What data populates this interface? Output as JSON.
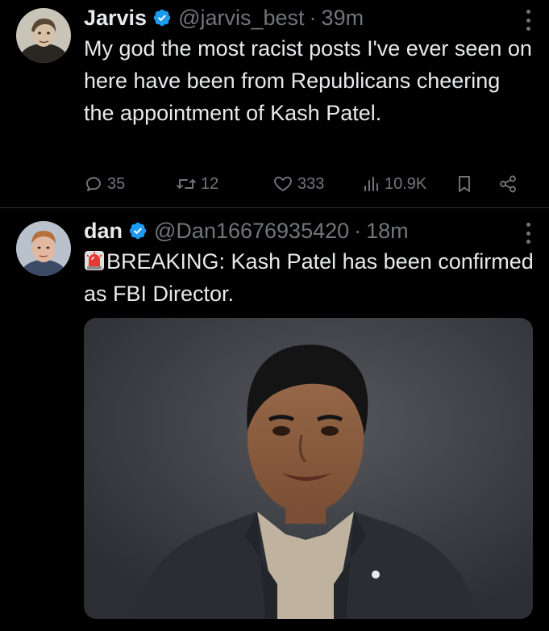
{
  "tweets": [
    {
      "display_name": "Jarvis",
      "handle": "@jarvis_best",
      "separator": "·",
      "time": "39m",
      "text": "My god the most racist posts I've ever seen on here have been from Republicans cheering the appointment of Kash Patel.",
      "actions": {
        "replies": "35",
        "reposts": "12",
        "likes": "333",
        "views": "10.9K"
      }
    },
    {
      "display_name": "dan",
      "handle": "@Dan16676935420",
      "separator": "·",
      "time": "18m",
      "emoji": "siren",
      "text": "BREAKING: Kash Patel has been confirmed as FBI Director.",
      "media": "photo-man-in-dark-blazer"
    }
  ],
  "icons": [
    "verified-badge-icon",
    "more-icon",
    "reply-icon",
    "repost-icon",
    "like-icon",
    "views-icon",
    "bookmark-icon",
    "share-icon",
    "siren-icon"
  ],
  "colors": {
    "background": "#000000",
    "text": "#e7e9ea",
    "muted": "#71767b",
    "divider": "#2f3336",
    "verified": "#1d9bf0"
  }
}
